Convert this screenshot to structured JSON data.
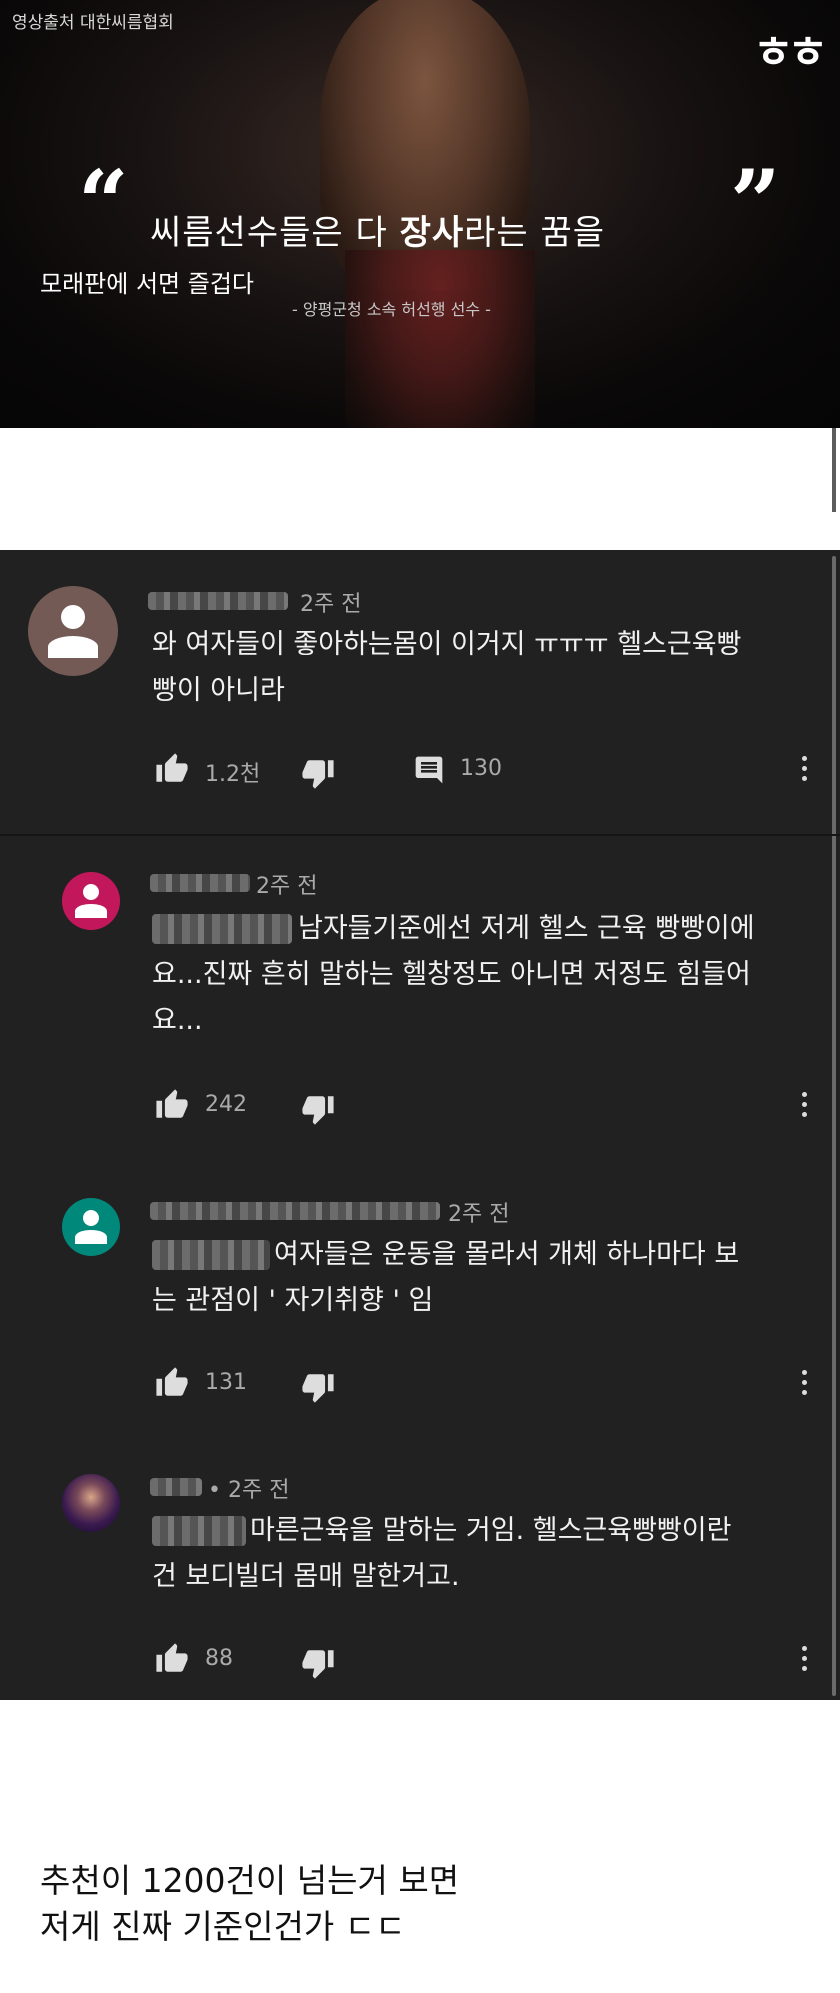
{
  "thumbnail": {
    "source": "영상출처 대한씨름협회",
    "logo": "ㅎㅎ",
    "quote_open": "“",
    "quote_close": "”",
    "headline_pre": "씨름선수들은 다 ",
    "headline_bold": "장사",
    "headline_post": "라는 꿈을",
    "subline": "모래판에 서면 즐겁다",
    "credit": "- 양평군청 소속 허선행 선수 -"
  },
  "comments": [
    {
      "time": "2주 전",
      "text_line1": "와 여자들이 좋아하는몸이 이거지 ㅠㅠㅠ 헬스근육빵",
      "text_line2": "빵이 아니라",
      "likes": "1.2천",
      "replies": "130",
      "avatar_color": "#735a54"
    },
    {
      "time": "2주 전",
      "text_line1": "남자들기준에선 저게 헬스 근육 빵빵이에",
      "text_line2": "요...진짜 흔히 말하는 헬창정도 아니면 저정도 힘들어",
      "text_line3": "요...",
      "likes": "242",
      "avatar_color": "#c2185b"
    },
    {
      "time": "2주 전",
      "text_line1": "여자들은 운동을 몰라서 개체 하나마다 보",
      "text_line2": "는 관점이 ' 자기취향 ' 임",
      "likes": "131",
      "avatar_color": "#00897b"
    },
    {
      "time": "• 2주 전",
      "text_line1": "마른근육을 말하는 거임. 헬스근육빵빵이란",
      "text_line2": "건 보디빌더 몸매 말한거고.",
      "likes": "88",
      "avatar_color": "#1a1030"
    }
  ],
  "icons": {
    "like": "thumb-up-icon",
    "dislike": "thumb-down-icon",
    "reply": "comment-icon",
    "more": "more-vert-icon"
  },
  "caption": {
    "line1": "추천이 1200건이 넘는거 보면",
    "line2": "저게 진짜 기준인건가 ㄷㄷ"
  }
}
